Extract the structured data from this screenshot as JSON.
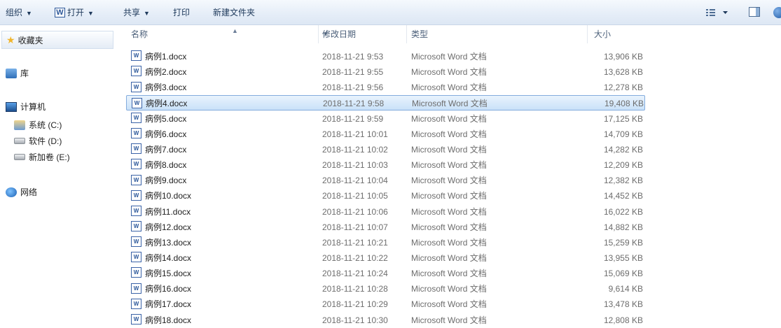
{
  "toolbar": {
    "organize": "组织",
    "open": "打开",
    "word_badge": "W",
    "share": "共享",
    "print": "打印",
    "new_folder": "新建文件夹"
  },
  "nav": {
    "favorites": "收藏夹",
    "libraries": "库",
    "computer": "计算机",
    "drive_c": "系统 (C:)",
    "drive_d": "软件 (D:)",
    "drive_e": "新加卷 (E:)",
    "network": "网络"
  },
  "columns": {
    "name": "名称",
    "date": "修改日期",
    "type": "类型",
    "size": "大小"
  },
  "files": [
    {
      "name": "病例1.docx",
      "date": "2018-11-21 9:53",
      "type": "Microsoft Word 文档",
      "size": "13,906 KB"
    },
    {
      "name": "病例2.docx",
      "date": "2018-11-21 9:55",
      "type": "Microsoft Word 文档",
      "size": "13,628 KB"
    },
    {
      "name": "病例3.docx",
      "date": "2018-11-21 9:56",
      "type": "Microsoft Word 文档",
      "size": "12,278 KB"
    },
    {
      "name": "病例4.docx",
      "date": "2018-11-21 9:58",
      "type": "Microsoft Word 文档",
      "size": "19,408 KB"
    },
    {
      "name": "病例5.docx",
      "date": "2018-11-21 9:59",
      "type": "Microsoft Word 文档",
      "size": "17,125 KB"
    },
    {
      "name": "病例6.docx",
      "date": "2018-11-21 10:01",
      "type": "Microsoft Word 文档",
      "size": "14,709 KB"
    },
    {
      "name": "病例7.docx",
      "date": "2018-11-21 10:02",
      "type": "Microsoft Word 文档",
      "size": "14,282 KB"
    },
    {
      "name": "病例8.docx",
      "date": "2018-11-21 10:03",
      "type": "Microsoft Word 文档",
      "size": "12,209 KB"
    },
    {
      "name": "病例9.docx",
      "date": "2018-11-21 10:04",
      "type": "Microsoft Word 文档",
      "size": "12,382 KB"
    },
    {
      "name": "病例10.docx",
      "date": "2018-11-21 10:05",
      "type": "Microsoft Word 文档",
      "size": "14,452 KB"
    },
    {
      "name": "病例11.docx",
      "date": "2018-11-21 10:06",
      "type": "Microsoft Word 文档",
      "size": "16,022 KB"
    },
    {
      "name": "病例12.docx",
      "date": "2018-11-21 10:07",
      "type": "Microsoft Word 文档",
      "size": "14,882 KB"
    },
    {
      "name": "病例13.docx",
      "date": "2018-11-21 10:21",
      "type": "Microsoft Word 文档",
      "size": "15,259 KB"
    },
    {
      "name": "病例14.docx",
      "date": "2018-11-21 10:22",
      "type": "Microsoft Word 文档",
      "size": "13,955 KB"
    },
    {
      "name": "病例15.docx",
      "date": "2018-11-21 10:24",
      "type": "Microsoft Word 文档",
      "size": "15,069 KB"
    },
    {
      "name": "病例16.docx",
      "date": "2018-11-21 10:28",
      "type": "Microsoft Word 文档",
      "size": "9,614 KB"
    },
    {
      "name": "病例17.docx",
      "date": "2018-11-21 10:29",
      "type": "Microsoft Word 文档",
      "size": "13,478 KB"
    },
    {
      "name": "病例18.docx",
      "date": "2018-11-21 10:30",
      "type": "Microsoft Word 文档",
      "size": "12,808 KB"
    }
  ],
  "selected_index": 3,
  "icons": {
    "file": "word-doc-icon",
    "favorites": "star-icon",
    "libraries": "library-icon",
    "computer": "computer-icon",
    "drive": "drive-icon",
    "network": "network-icon",
    "view": "view-options-icon",
    "preview": "preview-pane-icon",
    "help": "help-icon"
  },
  "colors": {
    "selection_bg": "#cce4f7",
    "selection_border": "#84acdd",
    "toolbar_text": "#1e395b"
  }
}
